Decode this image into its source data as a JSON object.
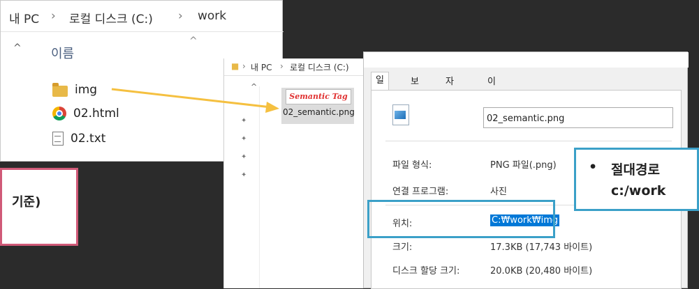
{
  "explorer_main": {
    "breadcrumb": [
      "내 PC",
      "로컬 디스크 (C:)",
      "work"
    ],
    "breadcrumb_sep": "›",
    "column_header": "이름",
    "files": [
      {
        "name": "img",
        "icon": "folder-icon"
      },
      {
        "name": "02.html",
        "icon": "chrome-icon"
      },
      {
        "name": "02.txt",
        "icon": "text-file-icon"
      }
    ]
  },
  "left_callout": {
    "text": "기준)"
  },
  "explorer_img": {
    "breadcrumb": [
      "내 PC",
      "로컬 디스크 (C:)"
    ],
    "breadcrumb_sep": "›",
    "thumbnail_text": "Semantic Tag",
    "file_name": "02_semantic.png"
  },
  "properties": {
    "tabs": [
      "일반",
      "보안",
      "자세히",
      "이전 버전"
    ],
    "file_name": "02_semantic.png",
    "fields": [
      {
        "label": "파일 형식:",
        "value": "PNG 파일(.png)"
      },
      {
        "label": "연결 프로그램:",
        "value": "사진"
      },
      {
        "label": "위치:",
        "value": "C:₩work₩img"
      },
      {
        "label": "크기:",
        "value": "17.3KB (17,743 바이트)"
      },
      {
        "label": "디스크 할당 크기:",
        "value": "20.0KB (20,480 바이트)"
      }
    ]
  },
  "right_callout": {
    "bullet": "•",
    "line1": "절대경로",
    "line2": "c:/work"
  },
  "colors": {
    "highlight_blue": "#3ba0c8",
    "pink": "#d05a78",
    "arrow_yellow": "#f5c040",
    "selection": "#0078d7"
  }
}
